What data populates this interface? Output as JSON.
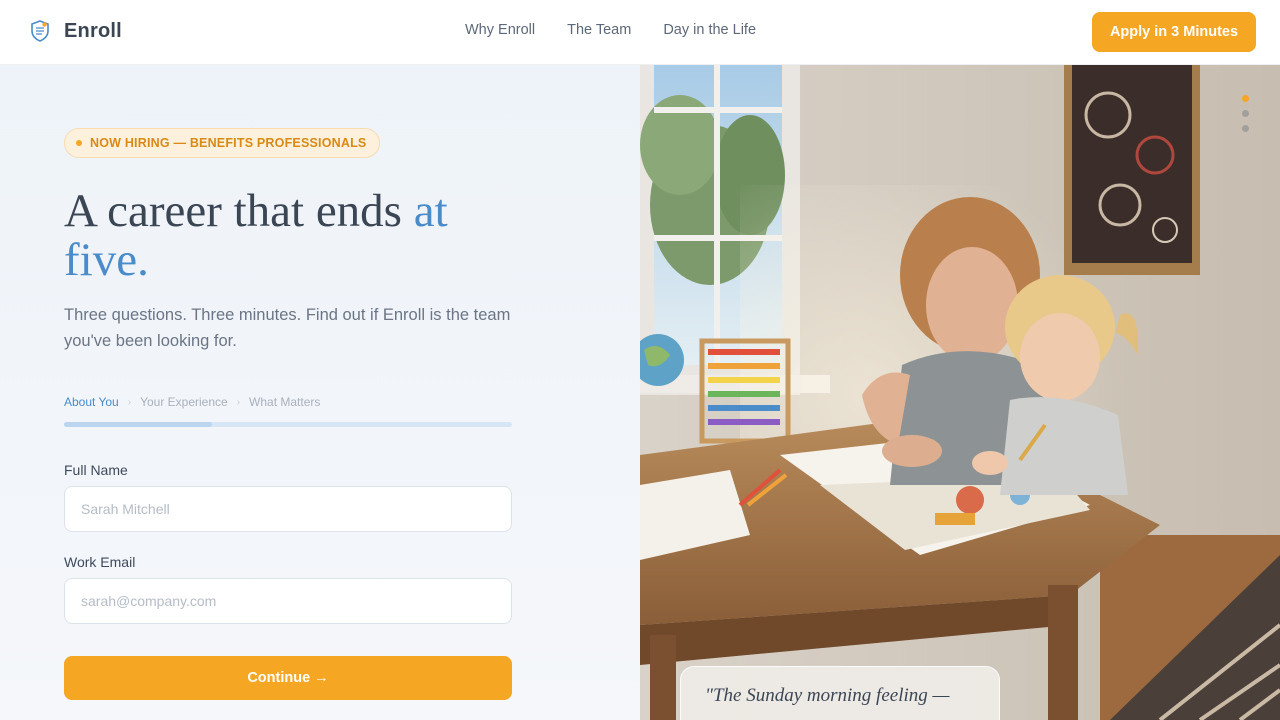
{
  "brand": {
    "name": "Enroll"
  },
  "nav": {
    "items": [
      {
        "label": "Why Enroll"
      },
      {
        "label": "The Team"
      },
      {
        "label": "Day in the Life"
      }
    ],
    "cta_label": "Apply in 3 Minutes"
  },
  "hero": {
    "badge": "NOW HIRING — BENEFITS PROFESSIONALS",
    "headline_main": "A career that ends",
    "headline_accent_1": "at",
    "headline_accent_2": "five.",
    "subtitle": "Three questions. Three minutes. Find out if Enroll is the team you've been looking for."
  },
  "form": {
    "steps": [
      {
        "label": "About You",
        "active": true
      },
      {
        "label": "Your Experience",
        "active": false
      },
      {
        "label": "What Matters",
        "active": false
      }
    ],
    "step_separator": "›",
    "progress": 0.33,
    "fields": [
      {
        "label": "Full Name",
        "placeholder": "Sarah Mitchell",
        "value": ""
      },
      {
        "label": "Work Email",
        "placeholder": "sarah@company.com",
        "value": ""
      }
    ],
    "submit_label": "Continue →"
  },
  "showcase": {
    "slide_count": 3,
    "active_slide": 1,
    "quote": "\"The Sunday morning feeling —"
  },
  "colors": {
    "accent": "#f5a623",
    "brand_blue": "#4a8bc9",
    "heading": "#3b4654"
  }
}
